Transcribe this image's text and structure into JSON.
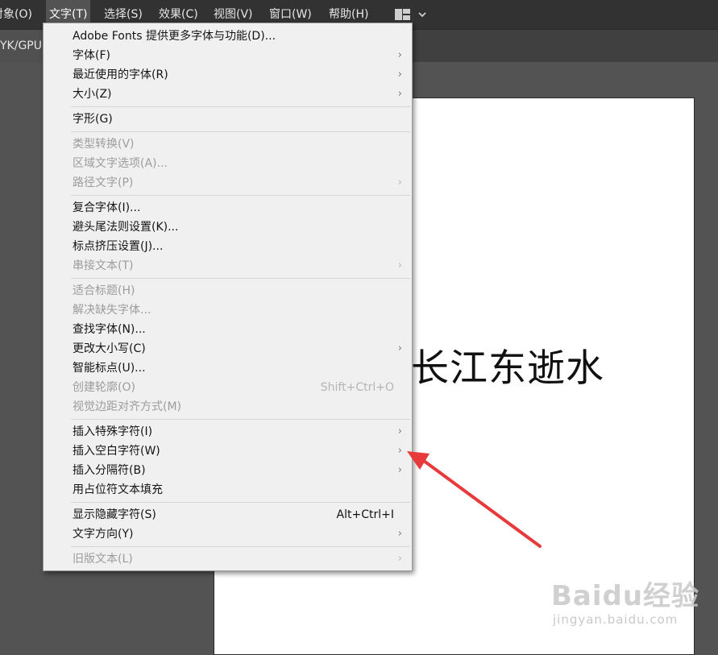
{
  "menubar": {
    "items": [
      "对象(O)",
      "文字(T)",
      "选择(S)",
      "效果(C)",
      "视图(V)",
      "窗口(W)",
      "帮助(H)"
    ]
  },
  "doc_tab": "YK/GPU",
  "artboard_text": "长江东逝水",
  "menu": {
    "sections": [
      [
        {
          "label": "Adobe Fonts 提供更多字体与功能(D)...",
          "disabled": false,
          "submenu": false,
          "shortcut": ""
        },
        {
          "label": "字体(F)",
          "disabled": false,
          "submenu": true,
          "shortcut": ""
        },
        {
          "label": "最近使用的字体(R)",
          "disabled": false,
          "submenu": true,
          "shortcut": ""
        },
        {
          "label": "大小(Z)",
          "disabled": false,
          "submenu": true,
          "shortcut": ""
        }
      ],
      [
        {
          "label": "字形(G)",
          "disabled": false,
          "submenu": false,
          "shortcut": ""
        }
      ],
      [
        {
          "label": "类型转换(V)",
          "disabled": true,
          "submenu": false,
          "shortcut": ""
        },
        {
          "label": "区域文字选项(A)...",
          "disabled": true,
          "submenu": false,
          "shortcut": ""
        },
        {
          "label": "路径文字(P)",
          "disabled": true,
          "submenu": true,
          "shortcut": ""
        }
      ],
      [
        {
          "label": "复合字体(I)...",
          "disabled": false,
          "submenu": false,
          "shortcut": ""
        },
        {
          "label": "避头尾法则设置(K)...",
          "disabled": false,
          "submenu": false,
          "shortcut": ""
        },
        {
          "label": "标点挤压设置(J)...",
          "disabled": false,
          "submenu": false,
          "shortcut": ""
        },
        {
          "label": "串接文本(T)",
          "disabled": true,
          "submenu": true,
          "shortcut": ""
        }
      ],
      [
        {
          "label": "适合标题(H)",
          "disabled": true,
          "submenu": false,
          "shortcut": ""
        },
        {
          "label": "解决缺失字体...",
          "disabled": true,
          "submenu": false,
          "shortcut": ""
        },
        {
          "label": "查找字体(N)...",
          "disabled": false,
          "submenu": false,
          "shortcut": ""
        },
        {
          "label": "更改大小写(C)",
          "disabled": false,
          "submenu": true,
          "shortcut": ""
        },
        {
          "label": "智能标点(U)...",
          "disabled": false,
          "submenu": false,
          "shortcut": ""
        },
        {
          "label": "创建轮廓(O)",
          "disabled": true,
          "submenu": false,
          "shortcut": "Shift+Ctrl+O"
        },
        {
          "label": "视觉边距对齐方式(M)",
          "disabled": true,
          "submenu": false,
          "shortcut": ""
        }
      ],
      [
        {
          "label": "插入特殊字符(I)",
          "disabled": false,
          "submenu": true,
          "shortcut": ""
        },
        {
          "label": "插入空白字符(W)",
          "disabled": false,
          "submenu": true,
          "shortcut": ""
        },
        {
          "label": "插入分隔符(B)",
          "disabled": false,
          "submenu": true,
          "shortcut": ""
        },
        {
          "label": "用占位符文本填充",
          "disabled": false,
          "submenu": false,
          "shortcut": ""
        }
      ],
      [
        {
          "label": "显示隐藏字符(S)",
          "disabled": false,
          "submenu": false,
          "shortcut": "Alt+Ctrl+I"
        },
        {
          "label": "文字方向(Y)",
          "disabled": false,
          "submenu": true,
          "shortcut": ""
        }
      ],
      [
        {
          "label": "旧版文本(L)",
          "disabled": true,
          "submenu": true,
          "shortcut": ""
        }
      ]
    ]
  },
  "watermark": {
    "brand": "Baidu经验",
    "url": "jingyan.baidu.com"
  },
  "colors": {
    "annotation_arrow": "#e83a3a"
  }
}
